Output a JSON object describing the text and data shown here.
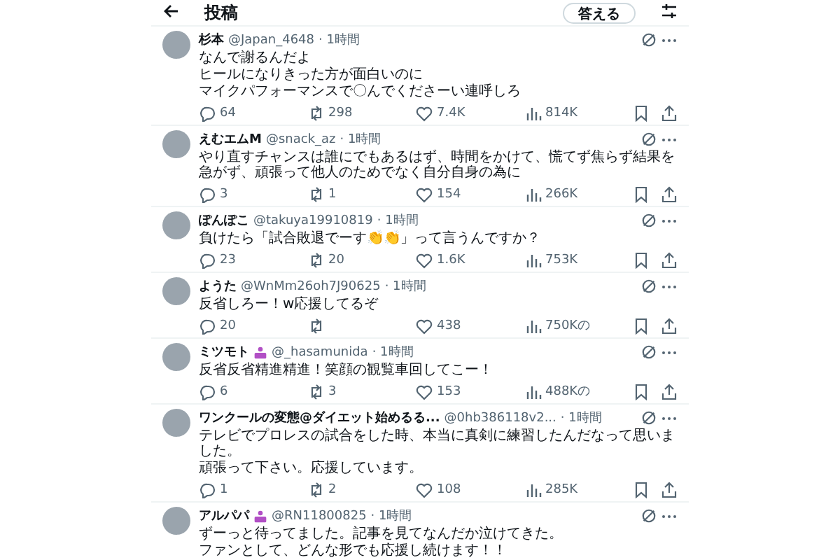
{
  "header": {
    "title": "投稿",
    "reply_button": "答える"
  },
  "replies": [
    {
      "name": "杉本",
      "badge": false,
      "handle": "@Japan_4648",
      "time": "· 1時間",
      "lines": [
        "なんで謝るんだよ",
        "ヒールになりきった方が面白いのに",
        "マイクパフォーマンスで〇んでくださーい連呼しろ"
      ],
      "actions": {
        "replies": "64",
        "reposts": "298",
        "likes": "7.4K",
        "views": "814K"
      }
    },
    {
      "name": "えむエムM",
      "badge": false,
      "handle": "@snack_az",
      "time": "· 1時間",
      "lines": [
        "やり直すチャンスは誰にでもあるはず、時間をかけて、慌てず焦らず結果を急がず、頑張って他人のためでなく自分自身の為に"
      ],
      "actions": {
        "replies": "3",
        "reposts": "1",
        "likes": "154",
        "views": "266K"
      }
    },
    {
      "name": "ぽんぽこ",
      "badge": false,
      "handle": "@takuya19910819",
      "time": "· 1時間",
      "lines": [
        "負けたら「試合敗退でーす👏👏」って言うんですか？"
      ],
      "actions": {
        "replies": "23",
        "reposts": "20",
        "likes": "1.6K",
        "views": "753K"
      }
    },
    {
      "name": "ようた",
      "badge": false,
      "handle": "@WnMm26oh7J90625",
      "time": "· 1時間",
      "lines": [
        "反省しろー！w応援してるぞ"
      ],
      "actions": {
        "replies": "20",
        "likes": "438",
        "views": "750Kの"
      }
    },
    {
      "name": "ミツモト",
      "badge": true,
      "handle": "@_hasamunida",
      "time": "· 1時間",
      "lines": [
        "反省反省精進精進！笑顔の観覧車回してこー！"
      ],
      "actions": {
        "replies": "6",
        "reposts": "3",
        "likes": "153",
        "views": "488Kの"
      }
    },
    {
      "name": "ワンクールの変態@ダイエット始めるる...",
      "badge": false,
      "handle": "@0hb386118v2...",
      "time": "· 1時間",
      "lines": [
        "テレビでプロレスの試合をした時、本当に真剣に練習したんだなって思いました。",
        "頑張って下さい。応援しています。"
      ],
      "actions": {
        "replies": "1",
        "reposts": "2",
        "likes": "108",
        "views": "285K"
      }
    },
    {
      "name": "アルパパ",
      "badge": true,
      "handle": "@RN11800825",
      "time": "· 1時間",
      "lines": [
        "ずーっと待ってました。記事を見てなんだか泣けてきた。",
        "ファンとして、どんな形でも応援し続けます！！"
      ]
    }
  ]
}
